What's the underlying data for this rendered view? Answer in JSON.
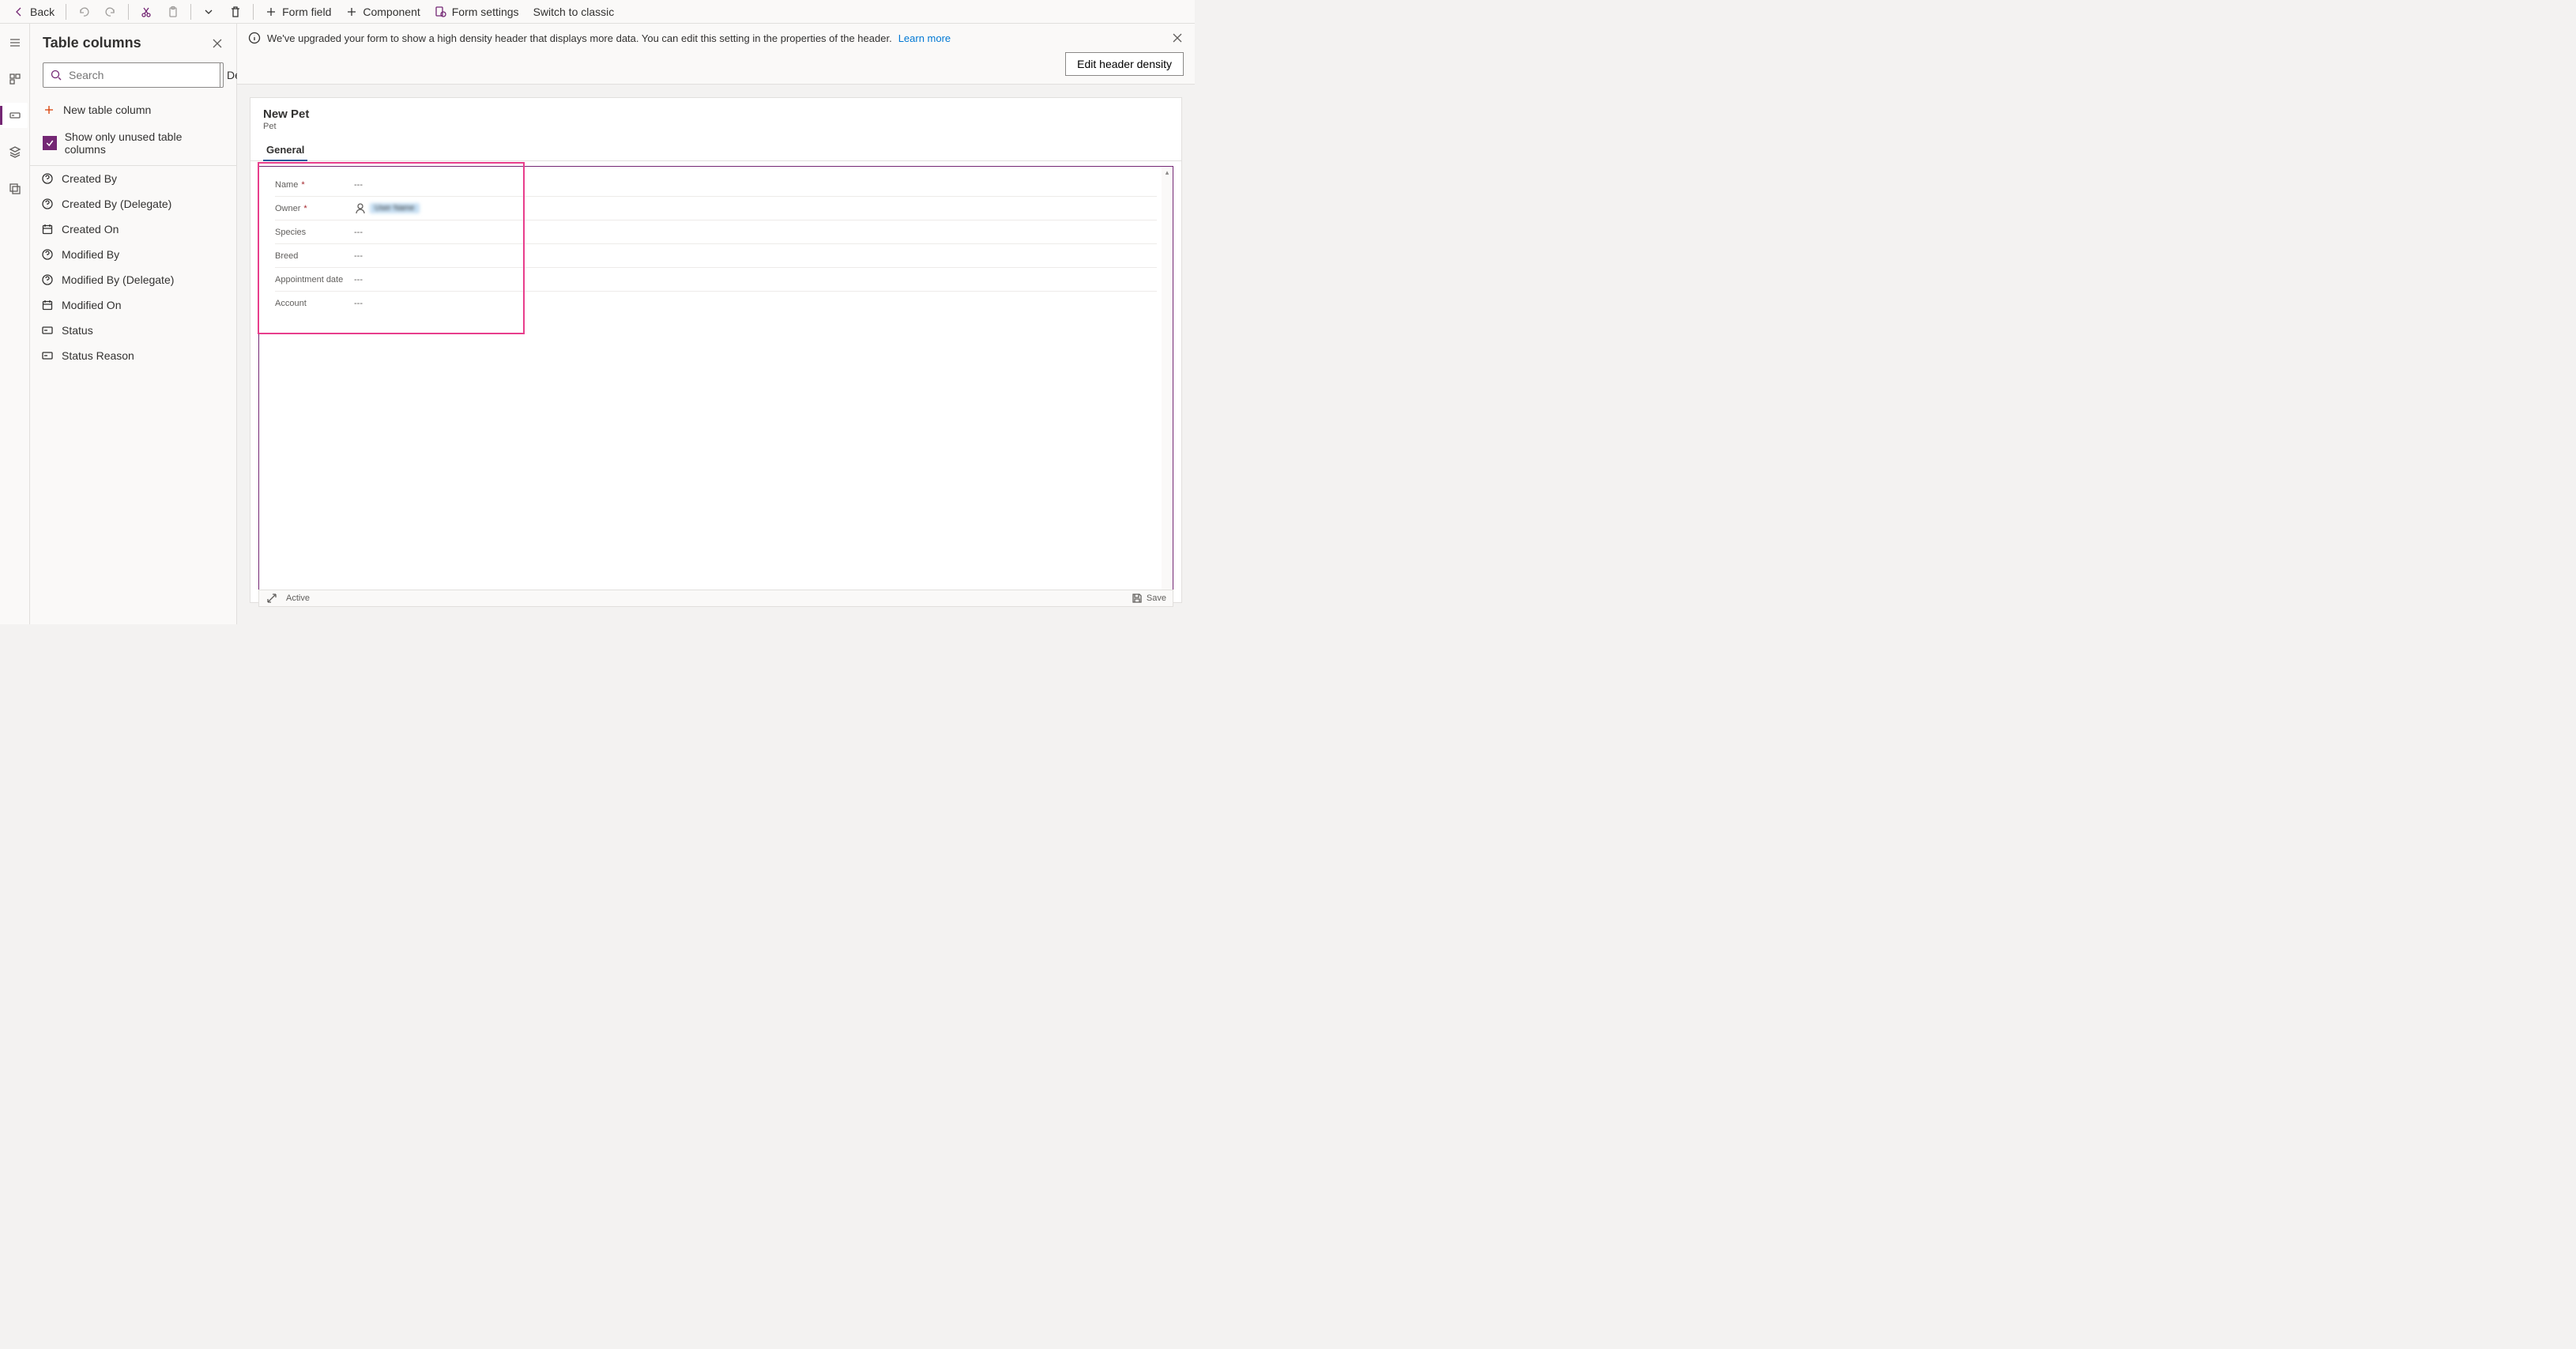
{
  "toolbar": {
    "back": "Back",
    "form_field": "Form field",
    "component": "Component",
    "form_settings": "Form settings",
    "switch_classic": "Switch to classic"
  },
  "rail": {
    "items": [
      "menu",
      "tree",
      "fields-active",
      "layers",
      "components"
    ]
  },
  "sidepanel": {
    "title": "Table columns",
    "search_placeholder": "Search",
    "filter_label": "Default",
    "new_column": "New table column",
    "show_unused": "Show only unused table columns",
    "columns": [
      {
        "icon": "q",
        "label": "Created By"
      },
      {
        "icon": "q",
        "label": "Created By (Delegate)"
      },
      {
        "icon": "cal",
        "label": "Created On"
      },
      {
        "icon": "q",
        "label": "Modified By"
      },
      {
        "icon": "q",
        "label": "Modified By (Delegate)"
      },
      {
        "icon": "cal",
        "label": "Modified On"
      },
      {
        "icon": "opt",
        "label": "Status"
      },
      {
        "icon": "opt",
        "label": "Status Reason"
      }
    ]
  },
  "banner": {
    "message": "We've upgraded your form to show a high density header that displays more data. You can edit this setting in the properties of the header.",
    "link": "Learn more",
    "button": "Edit header density"
  },
  "form": {
    "title": "New Pet",
    "subtitle": "Pet",
    "tab": "General",
    "fields": [
      {
        "label": "Name",
        "required": true,
        "value": "---",
        "type": "text"
      },
      {
        "label": "Owner",
        "required": true,
        "value": "",
        "type": "owner"
      },
      {
        "label": "Species",
        "required": false,
        "value": "---",
        "type": "text"
      },
      {
        "label": "Breed",
        "required": false,
        "value": "---",
        "type": "text"
      },
      {
        "label": "Appointment date",
        "required": false,
        "value": "---",
        "type": "text"
      },
      {
        "label": "Account",
        "required": false,
        "value": "---",
        "type": "text"
      }
    ],
    "footer_status": "Active",
    "footer_save": "Save"
  }
}
